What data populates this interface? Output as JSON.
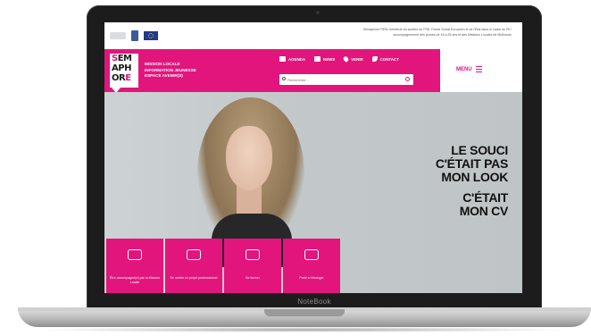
{
  "device": {
    "label": "NoteBook"
  },
  "site": {
    "topbar": {
      "notice_line1": "Semaphore PESL bénéficie du soutien du FSE, Fonds Social Européen et de l'État dans le cadre du PIC",
      "notice_line2": "accompagnement des jeunes de 16 à 25 ans et des Missions Locales de Mulhouse"
    },
    "brand": {
      "row1_a": "S",
      "row1_b": "EM",
      "row2_a": "A",
      "row2_b": "PH",
      "row3_a": "OR",
      "row3_b": "E",
      "tagline": [
        "Mission Locale",
        "Information Jeunesse",
        "Espace Avenir(s)"
      ]
    },
    "quicknav": [
      {
        "label": "Agenda",
        "icon": "calendar-icon"
      },
      {
        "label": "News",
        "icon": "news-icon"
      },
      {
        "label": "Venir",
        "icon": "location-pin-icon"
      },
      {
        "label": "Contact",
        "icon": "phone-icon"
      }
    ],
    "search": {
      "placeholder": "Rechercher..."
    },
    "menu": {
      "label": "MENU"
    },
    "hero": {
      "line1": "LE SOUCI",
      "line2": "C'ÉTAIT PAS",
      "line3": "MON LOOK",
      "line4": "C'ÉTAIT",
      "line5": "MON CV"
    },
    "services": [
      {
        "label": "Être accompagné(e) par la Mission Locale",
        "icon": "hand-heart-icon"
      },
      {
        "label": "Se mettre en projet professionnel",
        "icon": "briefcase-icon"
      },
      {
        "label": "Se former",
        "icon": "graduation-cap-icon"
      },
      {
        "label": "Partir à l'étranger",
        "icon": "plane-icon"
      }
    ]
  },
  "colors": {
    "brand_pink": "#e2157d",
    "laptop_frame": "#1c1c1d"
  }
}
